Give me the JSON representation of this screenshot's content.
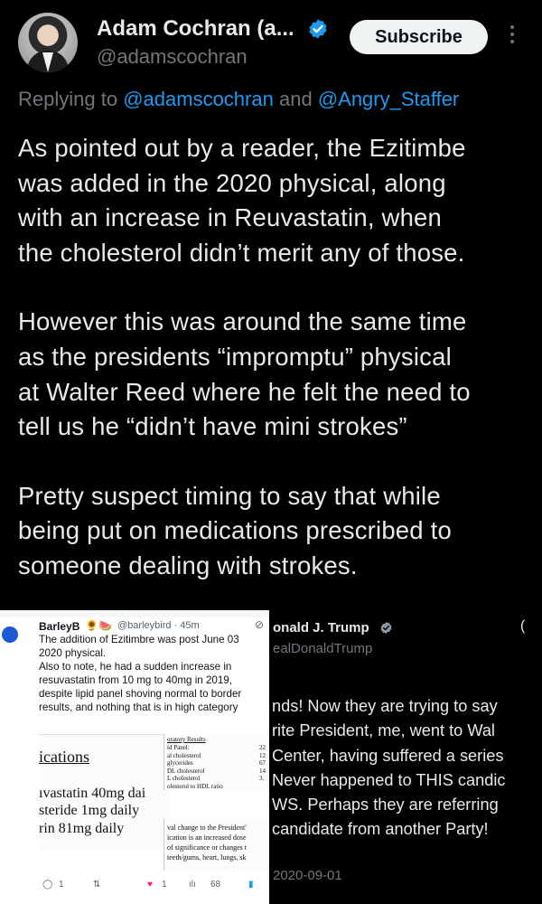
{
  "header": {
    "name": "Adam Cochran (a...",
    "handle": "@adamscochran",
    "subscribe_label": "Subscribe"
  },
  "reply": {
    "prefix": "Replying to",
    "handle1": "@adamscochran",
    "and": "and",
    "handle2": "@Angry_Staffer"
  },
  "tweet": {
    "paragraph1": "As pointed out by a reader, the Ezitimbe\nwas added in the 2020 physical, along\nwith an increase in Reuvastatin, when\nthe cholesterol didn’t merit any of those.",
    "paragraph2": "However this was around the same time\nas the presidents “impromptu” physical\nat Walter Reed where he felt the need to\ntell us he “didn’t have mini strokes”",
    "paragraph3": "Pretty suspect timing to say that while\nbeing put on medications prescribed to\nsomeone dealing with strokes."
  },
  "embedded_left": {
    "name": "BarleyB",
    "emoji": "🌻🍉",
    "handle": "@barleybird · 45m",
    "text": "The addition of Ezitimbre was post June 03\n2020 physical.\nAlso to note, he had a sudden increase in\nresuvastatin from 10 mg to 40mg in 2019,\ndespite lipid panel shoving normal to border\nresults, and nothing that is in high category",
    "doc_heading": "ications",
    "doc_line1": "ıvastatin 40mg dai",
    "doc_line2": "steride 1mg daily",
    "doc_line3": "rin 81mg daily",
    "lab_title": "oratory Results",
    "lab_lines": "id Panel:\nal cholesterol\nglycerides\nDL cholesterol\nL cholesterol\nolesterol to HDL ratio",
    "lab_values": "22\n12\n67\n14\n3.",
    "note_text": "val change to the President'\nication is an increased dose\nof significance or changes t\nteeth/gums, heart, lungs, sk",
    "reply_count": "1",
    "like_count": "1",
    "view_count": "68"
  },
  "embedded_right": {
    "name": "onald J. Trump",
    "handle": "ealDonaldTrump",
    "text": "nds! Now they are trying to say\nrite President, me, went to Wal\nCenter, having suffered a series\nNever happened to THIS candic\nWS. Perhaps they are referring\ncandidate from another Party!",
    "date": "2020-09-01"
  },
  "colors": {
    "background": "#000000",
    "link": "#1d9bf0",
    "muted": "#71767b",
    "verified": "#1d9bf0",
    "like": "#f91880"
  }
}
